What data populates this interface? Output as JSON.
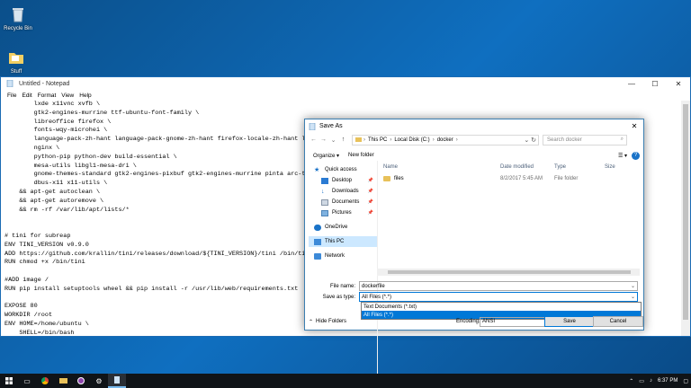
{
  "desktop": {
    "icons": [
      {
        "label": "Recycle Bin"
      },
      {
        "label": "Stuff"
      }
    ]
  },
  "notepad": {
    "title": "Untitled - Notepad",
    "menu": [
      "File",
      "Edit",
      "Format",
      "View",
      "Help"
    ],
    "content": "        lxde x11vnc xvfb \\\n        gtk2-engines-murrine ttf-ubuntu-font-family \\\n        libreoffice firefox \\\n        fonts-wqy-microhei \\\n        language-pack-zh-hant language-pack-gnome-zh-hant firefox-locale-zh-hant li\n        nginx \\\n        python-pip python-dev build-essential \\\n        mesa-utils libgl1-mesa-dri \\\n        gnome-themes-standard gtk2-engines-pixbuf gtk2-engines-murrine pinta arc-th\n        dbus-x11 x11-utils \\\n    && apt-get autoclean \\\n    && apt-get autoremove \\\n    && rm -rf /var/lib/apt/lists/*\n\n\n# tini for subreap\nENV TINI_VERSION v0.9.0\nADD https://github.com/krallin/tini/releases/download/${TINI_VERSION}/tini /bin/tin\nRUN chmod +x /bin/tini\n\n#ADD image /\nRUN pip install setuptools wheel && pip install -r /usr/lib/web/requirements.txt\n\nEXPOSE 80\nWORKDIR /root\nENV HOME=/home/ubuntu \\\n    SHELL=/bin/bash\nENTRYPOINT [\"/root/startup.sh\"]"
  },
  "dialog": {
    "title": "Save As",
    "breadcrumb": [
      "This PC",
      "Local Disk (C:)",
      "docker"
    ],
    "search_placeholder": "Search docker",
    "toolbar": {
      "organize": "Organize ▾",
      "new_folder": "New folder"
    },
    "nav": [
      {
        "label": "Quick access",
        "indent": false,
        "icon": "star-icon",
        "pinned": false
      },
      {
        "label": "Desktop",
        "indent": true,
        "icon": "desktop-icon",
        "pinned": true
      },
      {
        "label": "Downloads",
        "indent": true,
        "icon": "download-icon",
        "pinned": true
      },
      {
        "label": "Documents",
        "indent": true,
        "icon": "document-icon",
        "pinned": true
      },
      {
        "label": "Pictures",
        "indent": true,
        "icon": "picture-icon",
        "pinned": true
      },
      {
        "label": "OneDrive",
        "indent": false,
        "icon": "cloud-icon",
        "pinned": false
      },
      {
        "label": "This PC",
        "indent": false,
        "icon": "computer-icon",
        "pinned": false,
        "selected": true
      },
      {
        "label": "Network",
        "indent": false,
        "icon": "network-icon",
        "pinned": false
      }
    ],
    "columns": {
      "name": "Name",
      "date": "Date modified",
      "type": "Type",
      "size": "Size"
    },
    "files": [
      {
        "name": "files",
        "date": "8/2/2017 5:45 AM",
        "type": "File folder"
      }
    ],
    "file_name_label": "File name:",
    "file_name_value": "dockerfile",
    "save_type_label": "Save as type:",
    "save_type_value": "All Files  (*.*)",
    "type_options": [
      "Text Documents (*.txt)",
      "All Files  (*.*)"
    ],
    "hide_folders": "Hide Folders",
    "encoding_label": "Encoding:",
    "encoding_value": "ANSI",
    "save_button": "Save",
    "cancel_button": "Cancel"
  },
  "taskbar": {
    "time": "6:37 PM"
  },
  "colors": {
    "accent": "#0078d7",
    "selected_nav": "#cce8ff",
    "taskbar": "#101418"
  }
}
